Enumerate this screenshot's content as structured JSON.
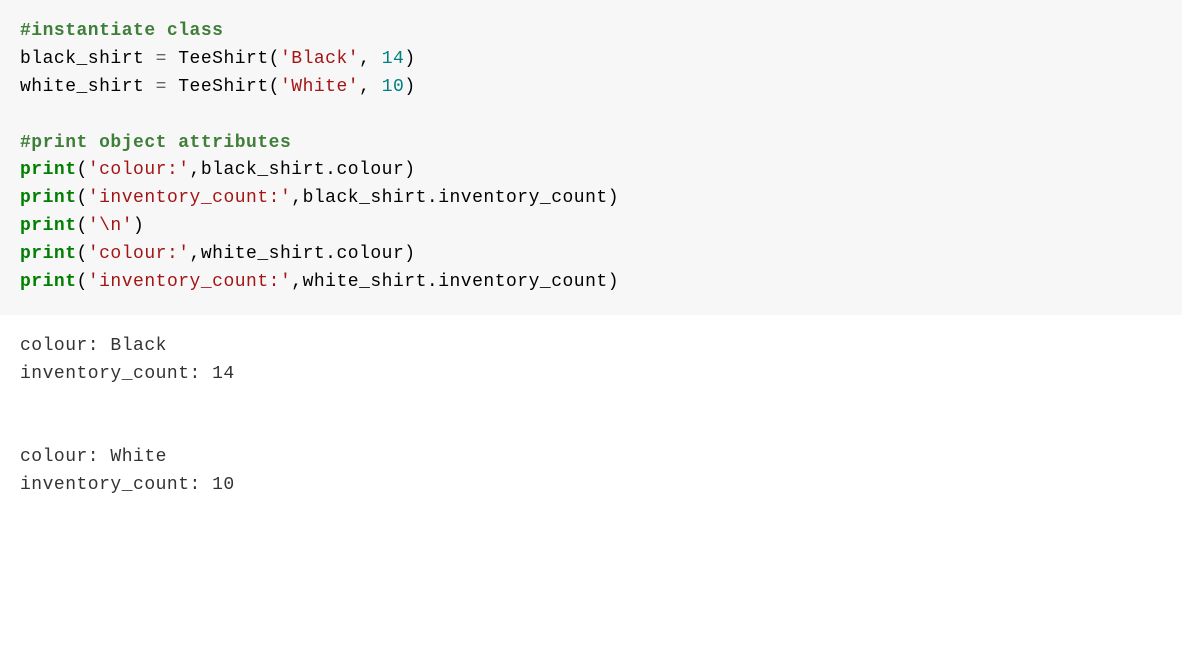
{
  "code": {
    "comment1": "#instantiate class",
    "line2_var": "black_shirt ",
    "line2_eq": "=",
    "line2_func": " TeeShirt(",
    "line2_str": "'Black'",
    "line2_comma": ", ",
    "line2_num": "14",
    "line2_close": ")",
    "line3_var": "white_shirt ",
    "line3_eq": "=",
    "line3_func": " TeeShirt(",
    "line3_str": "'White'",
    "line3_comma": ", ",
    "line3_num": "10",
    "line3_close": ")",
    "comment2": "#print object attributes",
    "line5_print": "print",
    "line5_open": "(",
    "line5_str": "'colour:'",
    "line5_rest": ",black_shirt.colour)",
    "line6_print": "print",
    "line6_open": "(",
    "line6_str": "'inventory_count:'",
    "line6_rest": ",black_shirt.inventory_count)",
    "line7_print": "print",
    "line7_open": "(",
    "line7_str": "'\\n'",
    "line7_rest": ")",
    "line8_print": "print",
    "line8_open": "(",
    "line8_str": "'colour:'",
    "line8_rest": ",white_shirt.colour)",
    "line9_print": "print",
    "line9_open": "(",
    "line9_str": "'inventory_count:'",
    "line9_rest": ",white_shirt.inventory_count)"
  },
  "output": {
    "line1": "colour: Black",
    "line2": "inventory_count: 14",
    "blank": " ",
    "line3": "colour: White",
    "line4": "inventory_count: 10"
  }
}
